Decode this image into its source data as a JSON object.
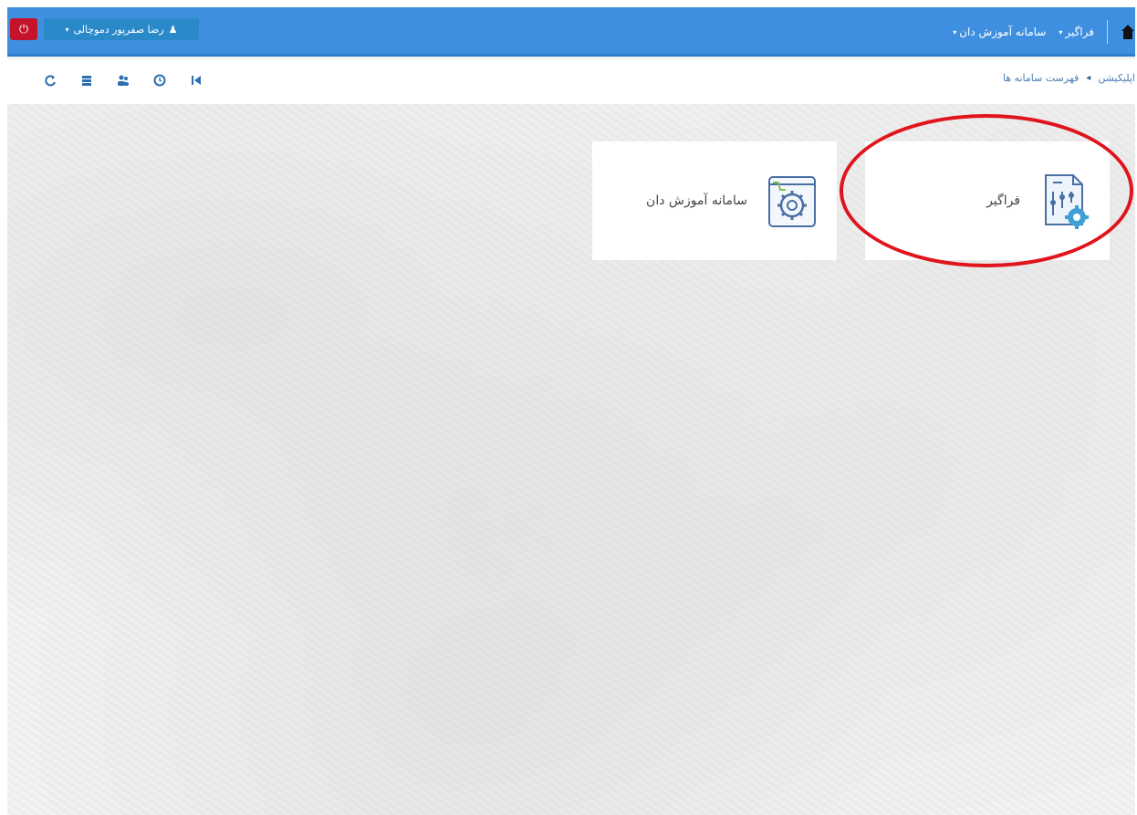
{
  "topbar": {
    "user_name": "رضا صفرپور دموچالی",
    "nav_items": [
      {
        "label": "فراگیر"
      },
      {
        "label": "سامانه آموزش دان"
      }
    ]
  },
  "breadcrumb": {
    "items": [
      "اپلیکیشن",
      "فهرست سامانه ها"
    ]
  },
  "cards": [
    {
      "label": "فراگیر",
      "icon": "settings-document-icon"
    },
    {
      "label": "سامانه آموزش دان",
      "icon": "gear-window-icon"
    }
  ],
  "colors": {
    "topbar": "#3f8fe0",
    "power": "#c4132b",
    "user": "#2a89c9",
    "highlight": "#e0141c"
  }
}
